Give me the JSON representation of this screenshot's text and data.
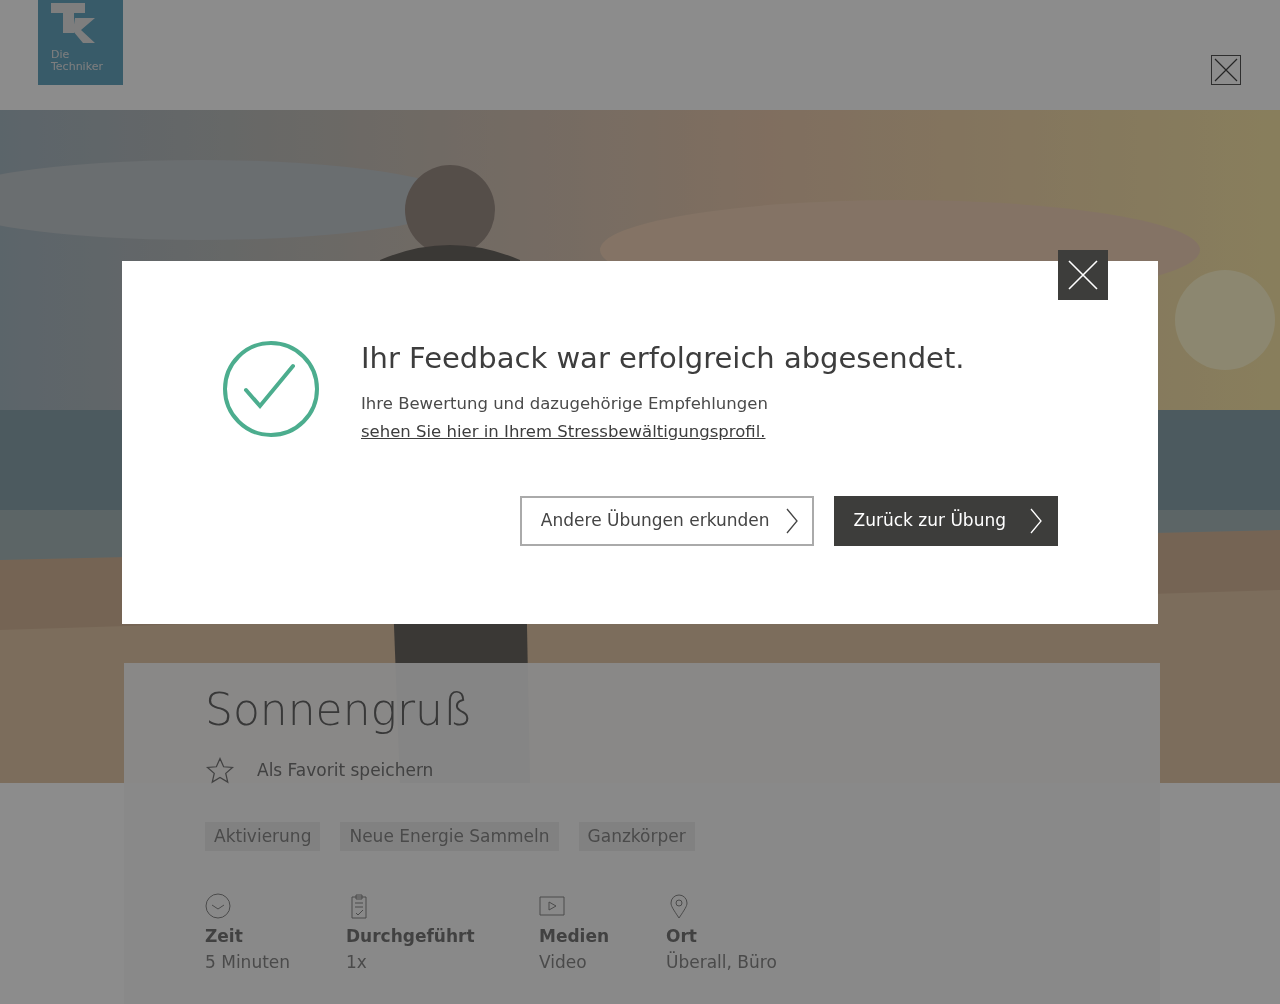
{
  "header": {
    "logo_text": [
      "Die",
      "Techniker"
    ]
  },
  "exercise": {
    "title": "Sonnengruß",
    "favorite": {
      "label": "Als Favorit speichern",
      "selected": false
    },
    "tags": [
      "Aktivierung",
      "Neue Energie Sammeln",
      "Ganzkörper"
    ],
    "facts": [
      {
        "kind": "time",
        "label": "Zeit",
        "value": "5 Minuten"
      },
      {
        "kind": "done",
        "label": "Durchgeführt",
        "value": "1x"
      },
      {
        "kind": "media",
        "label": "Medien",
        "value": "Video"
      },
      {
        "kind": "place",
        "label": "Ort",
        "value": "Überall, Büro"
      }
    ]
  },
  "dialog": {
    "title": "Ihr Feedback war erfolgreich abgesendet.",
    "text": "Ihre Bewertung und dazugehörige Empfehlungen",
    "link": "sehen Sie hier in Ihrem Stressbewältigungsprofil.",
    "buttons": [
      {
        "kind": "secondary",
        "label": "Andere Übungen erkunden"
      },
      {
        "kind": "primary",
        "label": "Zurück zur Übung"
      }
    ]
  }
}
